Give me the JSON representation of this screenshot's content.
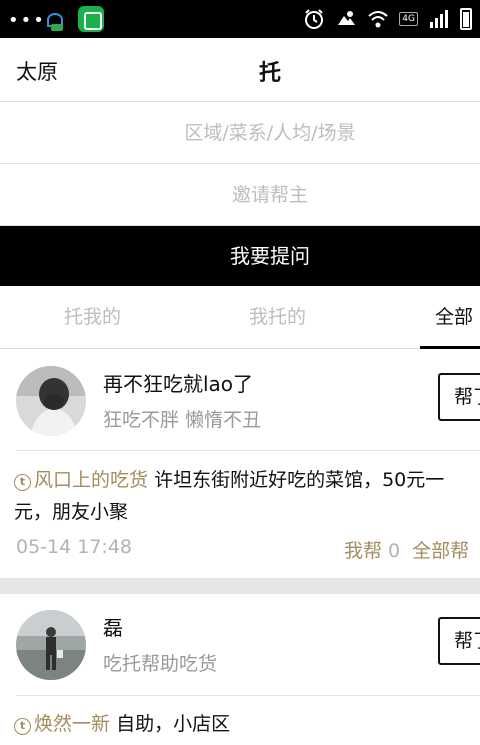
{
  "status_bar": {
    "dots": "•••",
    "network": "4G",
    "icons": [
      "chat-bubble-icon",
      "app-icon",
      "alarm-icon",
      "cloud-icon",
      "wifi-icon",
      "signal-icon",
      "battery-icon"
    ]
  },
  "header": {
    "city": "太原",
    "title": "托"
  },
  "form": {
    "filter_placeholder": "区域/菜系/人均/场景",
    "invite_placeholder": "邀请帮主",
    "ask_button": "我要提问"
  },
  "tabs": [
    {
      "label": "托我的",
      "active": false
    },
    {
      "label": "我托的",
      "active": false
    },
    {
      "label": "全部",
      "active": true
    }
  ],
  "posts": [
    {
      "user_name": "再不狂吃就lao了",
      "user_sub": "狂吃不胖 懒惰不丑",
      "help_button": "帮了",
      "t_mark": "t",
      "author": "风口上的吃货",
      "content": "许坦东街附近好吃的菜馆，50元一",
      "content_line2": "元，朋友小聚",
      "time": "05-14 17:48",
      "help_label": "我帮",
      "help_count": "0",
      "all_help_label": "全部帮"
    },
    {
      "user_name": "磊",
      "user_sub": "吃托帮助吃货",
      "help_button": "帮了",
      "t_mark": "t",
      "author": "焕然一新",
      "content": "自助，小店区"
    }
  ],
  "colors": {
    "accent": "#a38c5e",
    "muted": "#9a9a9a",
    "placeholder": "#bdbdbd",
    "black": "#000000"
  }
}
